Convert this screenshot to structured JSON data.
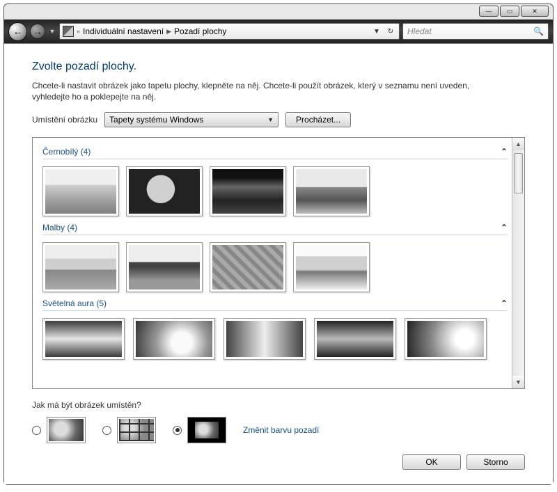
{
  "window": {
    "breadcrumb_prev": "Individuální nastavení",
    "breadcrumb_current": "Pozadí plochy",
    "search_placeholder": "Hledat"
  },
  "page": {
    "heading": "Zvolte pozadí plochy.",
    "description": "Chcete-li nastavit obrázek jako tapetu plochy, klepněte na něj. Chcete-li použít obrázek, který v seznamu není uveden, vyhledejte ho a poklepejte na něj.",
    "location_label": "Umístění obrázku",
    "location_value": "Tapety systému Windows",
    "browse_label": "Procházet..."
  },
  "groups": {
    "g1": "Černobílý (4)",
    "g2": "Malby (4)",
    "g3": "Světelná aura (5)"
  },
  "placement": {
    "question": "Jak má být obrázek umístěn?",
    "change_color": "Změnit barvu pozadí"
  },
  "buttons": {
    "ok": "OK",
    "cancel": "Storno"
  }
}
